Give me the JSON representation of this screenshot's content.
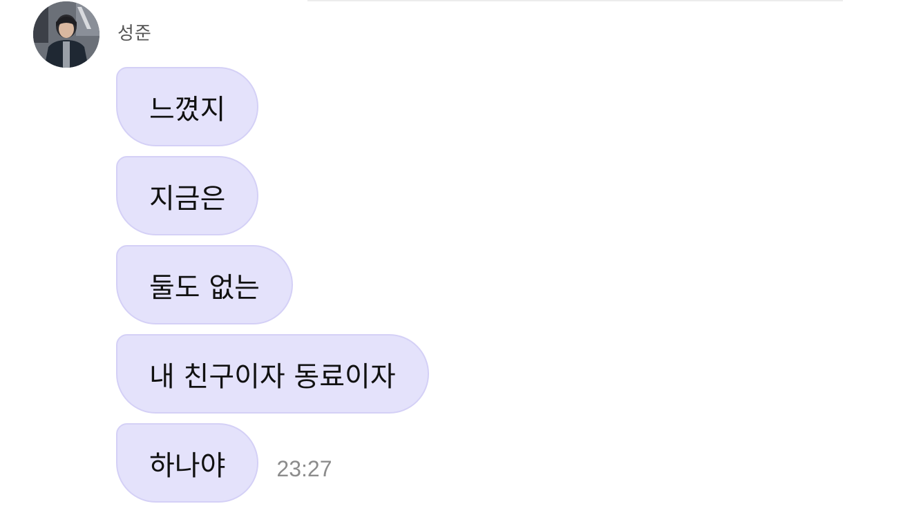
{
  "chat": {
    "sender_name": "성준",
    "messages": [
      {
        "text": "느꼈지"
      },
      {
        "text": "지금은"
      },
      {
        "text": "둘도 없는"
      },
      {
        "text": "내 친구이자 동료이자"
      },
      {
        "text": "하나야"
      }
    ],
    "last_timestamp": "23:27"
  },
  "colors": {
    "bubble_bg": "#e4e2fb",
    "bubble_border": "#d4d0f6",
    "timestamp": "#8c8c8c"
  },
  "icons": {
    "avatar": "profile-photo"
  }
}
